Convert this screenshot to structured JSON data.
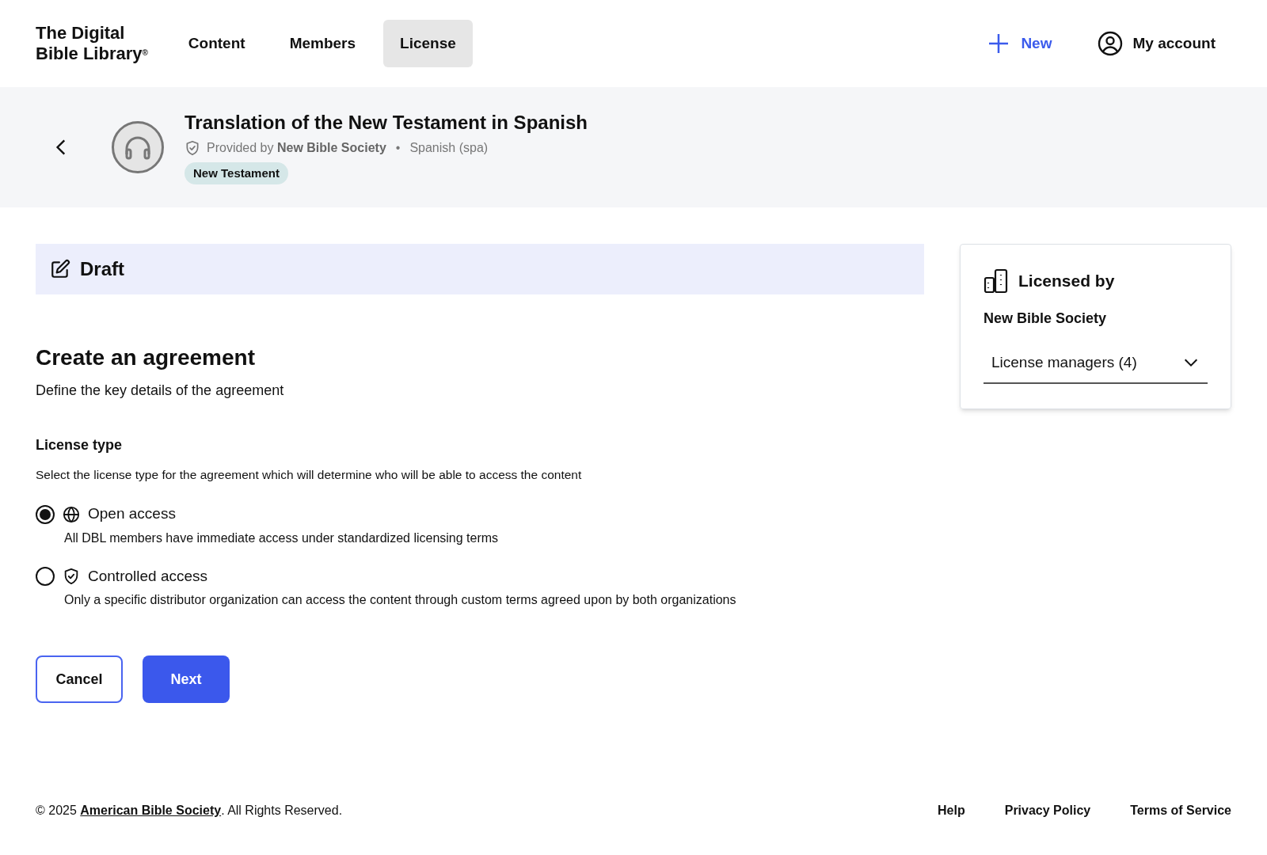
{
  "header": {
    "logo": {
      "line_1": "The Digital",
      "line_2": "Bible Library",
      "mark": "®"
    },
    "nav": [
      {
        "label": "Content",
        "selected": false
      },
      {
        "label": "Members",
        "selected": false
      },
      {
        "label": "License",
        "selected": true
      }
    ],
    "new_button": "New",
    "account_button": "My account"
  },
  "resource": {
    "title": "Translation of the New Testament in Spanish",
    "provided_by_prefix": "Provided by",
    "provider": "New Bible Society",
    "separator": "•",
    "language": "Spanish (spa)",
    "tag": "New Testament"
  },
  "status_banner": {
    "label": "Draft"
  },
  "form": {
    "heading": "Create an agreement",
    "subheading": "Define the key details of the agreement",
    "section_title": "License type",
    "section_description": "Select the license type for the agreement which will determine who will be able to access the content",
    "options": [
      {
        "kind": "globe",
        "label": "Open access",
        "description": "All DBL members have immediate access under standardized licensing terms",
        "selected": true
      },
      {
        "kind": "shield",
        "label": "Controlled access",
        "description": "Only a specific distributor organization can access the content through custom terms agreed upon by both organizations",
        "selected": false
      }
    ],
    "buttons": {
      "cancel": "Cancel",
      "next": "Next"
    }
  },
  "licensed_by": {
    "title": "Licensed by",
    "organization": "New Bible Society",
    "dropdown": "License managers (4)"
  },
  "footer": {
    "copyright_prefix": "© 2025",
    "copyright_link": "American Bible Society",
    "copyright_suffix": ". All Rights Reserved.",
    "links": [
      "Help",
      "Privacy Policy",
      "Terms of Service"
    ]
  }
}
